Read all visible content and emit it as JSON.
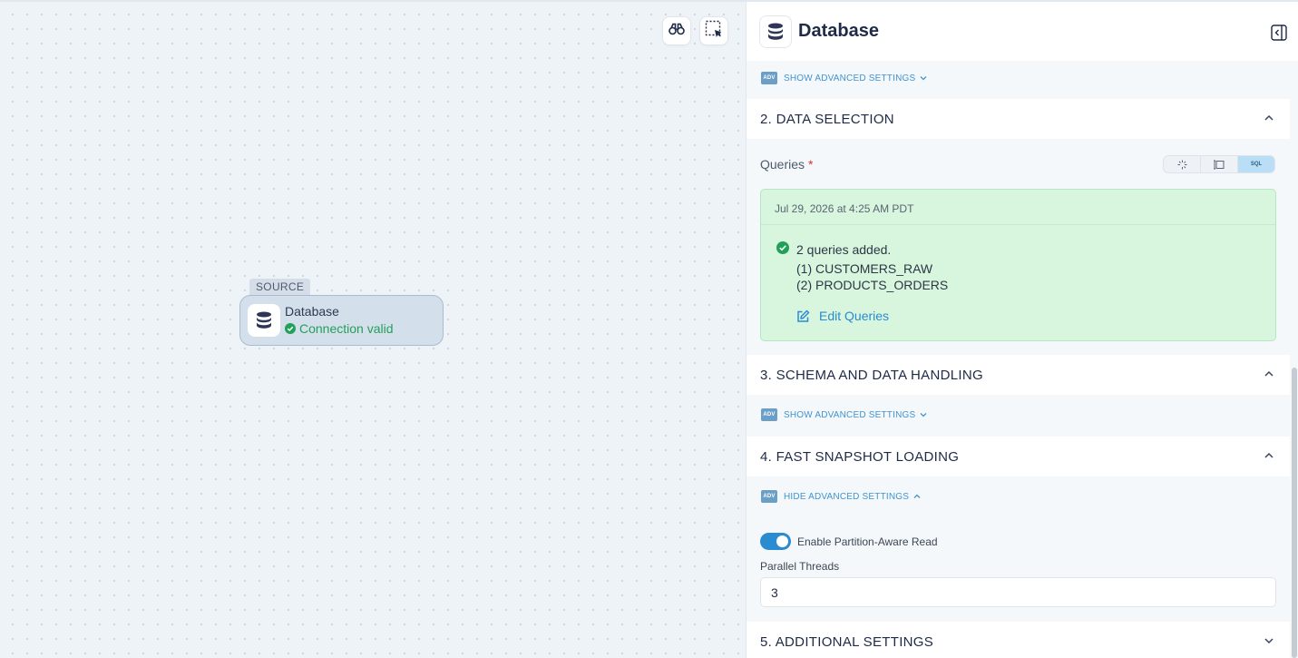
{
  "canvas": {
    "tools": [
      {
        "name": "binoculars-icon"
      },
      {
        "name": "selection-box-icon"
      }
    ],
    "node": {
      "tag": "SOURCE",
      "title": "Database",
      "status": "Connection valid",
      "status_color": "#22a05a"
    }
  },
  "panel": {
    "title": "Database",
    "advanced_1": "SHOW ADVANCED SETTINGS",
    "sections": [
      {
        "label": "2. DATA SELECTION",
        "expanded": true
      },
      {
        "label": "3. SCHEMA AND DATA HANDLING",
        "expanded": true
      },
      {
        "label": "4. FAST SNAPSHOT LOADING",
        "expanded": true
      },
      {
        "label": "5. ADDITIONAL SETTINGS",
        "expanded": false
      }
    ],
    "adv_badge": "ADV",
    "queries": {
      "label": "Queries",
      "required_mark": "*",
      "mode_options": [
        "wizard",
        "table-picker",
        "SQL"
      ],
      "active_mode": "SQL",
      "result": {
        "timestamp": "Jul 29, 2026 at 4:25 AM PDT",
        "summary": "2 queries added.",
        "items": [
          "(1) CUSTOMERS_RAW",
          "(2) PRODUCTS_ORDERS"
        ],
        "edit_label": "Edit Queries"
      }
    },
    "advanced_3": "SHOW ADVANCED SETTINGS",
    "advanced_4": "HIDE ADVANCED SETTINGS",
    "partition_toggle": {
      "label": "Enable Partition-Aware Read",
      "on": true
    },
    "parallel_threads": {
      "label": "Parallel Threads",
      "value": "3"
    }
  },
  "colors": {
    "accent": "#2a8bd1",
    "success_bg": "#d8f5de",
    "success": "#22a05a"
  }
}
